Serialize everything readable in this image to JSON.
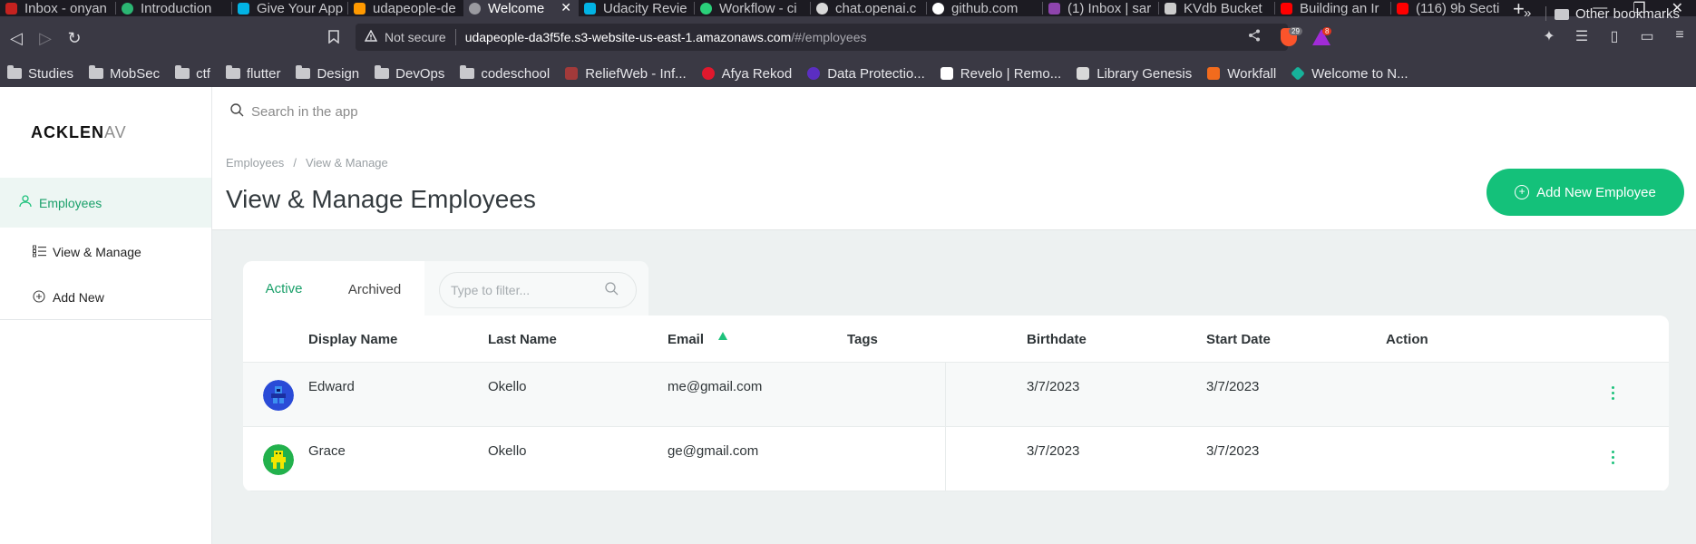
{
  "browser": {
    "tabs": [
      {
        "label": "Inbox - onyan",
        "color": "#c5221f"
      },
      {
        "label": "Introduction",
        "color": "#2bb673"
      },
      {
        "label": "Give Your App",
        "color": "#02b3e4"
      },
      {
        "label": "udapeople-de",
        "color": "#ff9900"
      },
      {
        "label": "Welcome",
        "color": "#9a9aa0"
      },
      {
        "label": "Udacity Revie",
        "color": "#02b3e4"
      },
      {
        "label": "Workflow - ci",
        "color": "#2ad07a"
      },
      {
        "label": "chat.openai.c",
        "color": "#d9d9d9"
      },
      {
        "label": "github.com",
        "color": "#ffffff"
      },
      {
        "label": "(1) Inbox | sar",
        "color": "#8e44ad"
      },
      {
        "label": "KVdb Bucket",
        "color": "#cccccc"
      },
      {
        "label": "Building an Ir",
        "color": "#ff0000"
      },
      {
        "label": "(116) 9b Secti",
        "color": "#ff0000"
      }
    ],
    "active_tab_close": "✕",
    "new_tab": "+",
    "window_controls": [
      "⌄",
      "—",
      "❐",
      "✕"
    ],
    "nav": {
      "back": "◁",
      "forward": "▷",
      "reload": "↻",
      "bookmark": "🔖"
    },
    "security_label": "Not secure",
    "url_host": "udapeople-da3f5fe.s3-website-us-east-1.amazonaws.com",
    "url_path": "/#/employees",
    "brave_badge": "29",
    "rewards_badge": "8",
    "bookmarks": [
      {
        "label": "Studies",
        "type": "folder"
      },
      {
        "label": "MobSec",
        "type": "folder"
      },
      {
        "label": "ctf",
        "type": "folder"
      },
      {
        "label": "flutter",
        "type": "folder"
      },
      {
        "label": "Design",
        "type": "folder"
      },
      {
        "label": "DevOps",
        "type": "folder"
      },
      {
        "label": "codeschool",
        "type": "folder"
      },
      {
        "label": "ReliefWeb - Inf...",
        "type": "site",
        "color": "#a23a3a"
      },
      {
        "label": "Afya Rekod",
        "type": "site",
        "color": "#e0182d"
      },
      {
        "label": "Data Protectio...",
        "type": "site",
        "color": "#5b2ec2"
      },
      {
        "label": "Revelo | Remo...",
        "type": "site",
        "color": "#ffffff"
      },
      {
        "label": "Library Genesis",
        "type": "site",
        "color": "#d8d8d8"
      },
      {
        "label": "Workfall",
        "type": "site",
        "color": "#f26b1d"
      },
      {
        "label": "Welcome to N...",
        "type": "site",
        "color": "#17b19a"
      }
    ],
    "bookmarks_more": "»",
    "other_bookmarks": "Other bookmarks"
  },
  "app": {
    "logo_main": "ACKLEN",
    "logo_fade": "AV",
    "sidebar": {
      "active": {
        "label": "Employees",
        "icon": "user-icon"
      },
      "items": [
        {
          "label": "View & Manage",
          "icon": "list-icon"
        },
        {
          "label": "Add New",
          "icon": "plus-circle-icon"
        }
      ]
    },
    "search_placeholder": "Search in the app",
    "breadcrumb": [
      "Employees",
      "View & Manage"
    ],
    "breadcrumb_sep": "/",
    "page_title": "View & Manage Employees",
    "add_button": "Add New Employee",
    "tabs": [
      "Active",
      "Archived"
    ],
    "filter_placeholder": "Type to filter...",
    "columns": [
      "Display Name",
      "Last Name",
      "Email",
      "Tags",
      "Birthdate",
      "Start Date",
      "Action"
    ],
    "sort_column": "Email",
    "rows": [
      {
        "display_name": "Edward",
        "last_name": "Okello",
        "email": "me@gmail.com",
        "tags": "",
        "birthdate": "3/7/2023",
        "start_date": "3/7/2023",
        "avatar_color": "#2a4bd7"
      },
      {
        "display_name": "Grace",
        "last_name": "Okello",
        "email": "ge@gmail.com",
        "tags": "",
        "birthdate": "3/7/2023",
        "start_date": "3/7/2023",
        "avatar_color": "#22b14c"
      }
    ],
    "accent_color": "#14c17a"
  }
}
